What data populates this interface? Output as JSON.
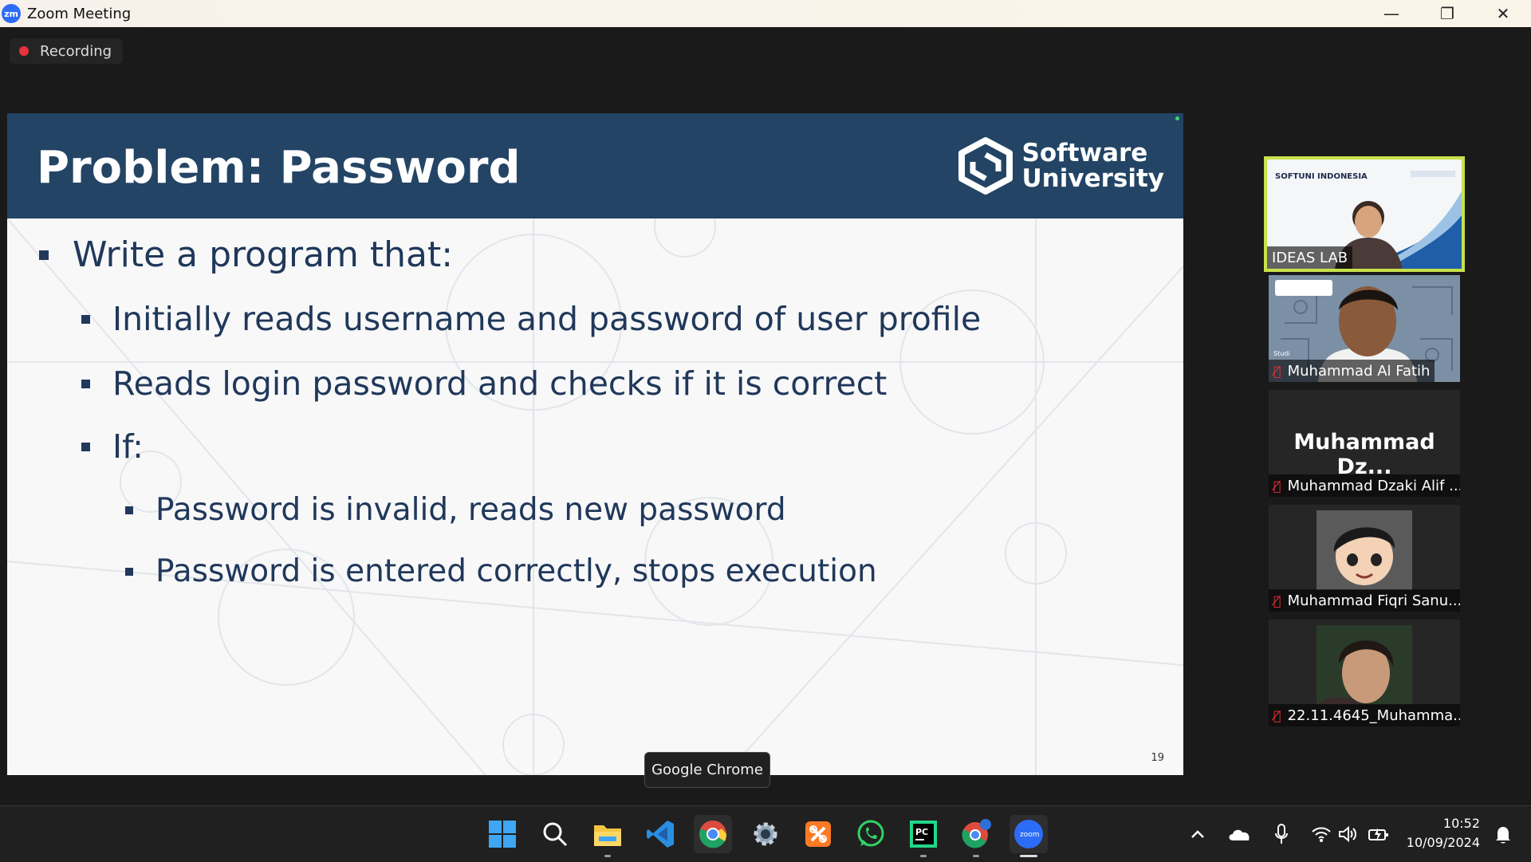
{
  "window": {
    "icon_text": "zm",
    "title": "Zoom Meeting",
    "minimize": "—",
    "restore": "❐",
    "close": "✕"
  },
  "recording": {
    "label": "Recording"
  },
  "slide": {
    "title": "Problem: Password",
    "brand_line1": "Software",
    "brand_line2": "University",
    "bullets": [
      {
        "level": 1,
        "text": "Write a program that:"
      },
      {
        "level": 2,
        "text": "Initially reads username and password of user profile"
      },
      {
        "level": 2,
        "text": "Reads login password and checks if it is correct"
      },
      {
        "level": 2,
        "text": "If:"
      },
      {
        "level": 3,
        "text": "Password is invalid, reads new password"
      },
      {
        "level": 3,
        "text": "Password is entered correctly, stops execution"
      }
    ],
    "number": "19"
  },
  "tooltip": {
    "text": "Google Chrome"
  },
  "participants": [
    {
      "name": "IDEAS LAB",
      "muted": false,
      "active": true,
      "banner": "SOFTUNI INDONESIA"
    },
    {
      "name": "Muhammad Al Fatih",
      "muted": true,
      "active": false,
      "sign": "Studi"
    },
    {
      "name": "Muhammad Dzaki Alif ...",
      "muted": true,
      "active": false,
      "display": "Muhammad  Dz..."
    },
    {
      "name": "Muhammad Fiqri Sanu...",
      "muted": true,
      "active": false
    },
    {
      "name": "22.11.4645_Muhamma...",
      "muted": true,
      "active": false
    }
  ],
  "taskbar": {
    "apps": [
      "windows-start",
      "search",
      "file-explorer",
      "vscode",
      "google-chrome",
      "settings",
      "xampp",
      "whatsapp",
      "pycharm",
      "chrome-profile",
      "zoom"
    ],
    "zoom_label": "zoom",
    "pycharm_label": "PC"
  },
  "clock": {
    "time": "10:52",
    "date": "10/09/2024"
  },
  "colors": {
    "slide_header": "#234465",
    "slide_text": "#20385a",
    "active_speaker": "#c7e24a",
    "muted_mic": "#e8323c"
  }
}
